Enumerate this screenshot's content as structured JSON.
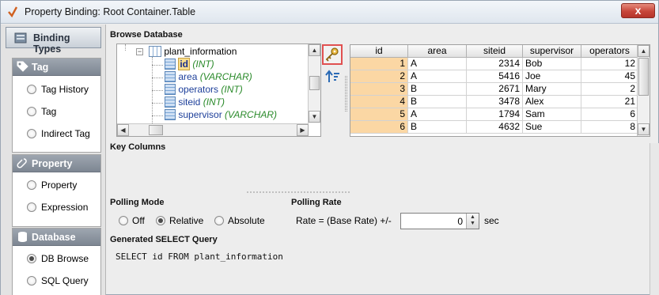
{
  "window": {
    "title": "Property Binding: Root Container.Table",
    "close_glyph": "x"
  },
  "sidebar": {
    "header": "Binding Types",
    "groups": [
      {
        "title": "Tag",
        "icon": "tag-icon",
        "items": [
          {
            "label": "Tag History",
            "selected": false
          },
          {
            "label": "Tag",
            "selected": false
          },
          {
            "label": "Indirect Tag",
            "selected": false
          }
        ]
      },
      {
        "title": "Property",
        "icon": "property-icon",
        "items": [
          {
            "label": "Property",
            "selected": false
          },
          {
            "label": "Expression",
            "selected": false
          }
        ]
      },
      {
        "title": "Database",
        "icon": "database-icon",
        "items": [
          {
            "label": "DB Browse",
            "selected": true
          },
          {
            "label": "SQL Query",
            "selected": false
          }
        ]
      }
    ]
  },
  "browse": {
    "label": "Browse Database",
    "tree": {
      "table": "plant_information",
      "columns": [
        {
          "name": "id",
          "type": "(INT)",
          "selected": true
        },
        {
          "name": "area",
          "type": "(VARCHAR)",
          "selected": false
        },
        {
          "name": "operators",
          "type": "(INT)",
          "selected": false
        },
        {
          "name": "siteid",
          "type": "(INT)",
          "selected": false
        },
        {
          "name": "supervisor",
          "type": "(VARCHAR)",
          "selected": false
        }
      ]
    }
  },
  "grid": {
    "headers": [
      "id",
      "area",
      "siteid",
      "supervisor",
      "operators"
    ],
    "rows": [
      [
        "1",
        "A",
        "2314",
        "Bob",
        "12"
      ],
      [
        "2",
        "A",
        "5416",
        "Joe",
        "45"
      ],
      [
        "3",
        "B",
        "2671",
        "Mary",
        "2"
      ],
      [
        "4",
        "B",
        "3478",
        "Alex",
        "21"
      ],
      [
        "5",
        "A",
        "1794",
        "Sam",
        "6"
      ],
      [
        "6",
        "B",
        "4632",
        "Sue",
        "8"
      ]
    ]
  },
  "key_columns": {
    "label": "Key Columns"
  },
  "polling": {
    "mode_label": "Polling Mode",
    "options": [
      "Off",
      "Relative",
      "Absolute"
    ],
    "selected": "Relative",
    "rate_label": "Polling Rate",
    "rate_text": "Rate = (Base Rate) +/-",
    "rate_value": "0",
    "unit": "sec"
  },
  "query": {
    "label": "Generated SELECT Query",
    "text": "SELECT id FROM plant_information"
  }
}
